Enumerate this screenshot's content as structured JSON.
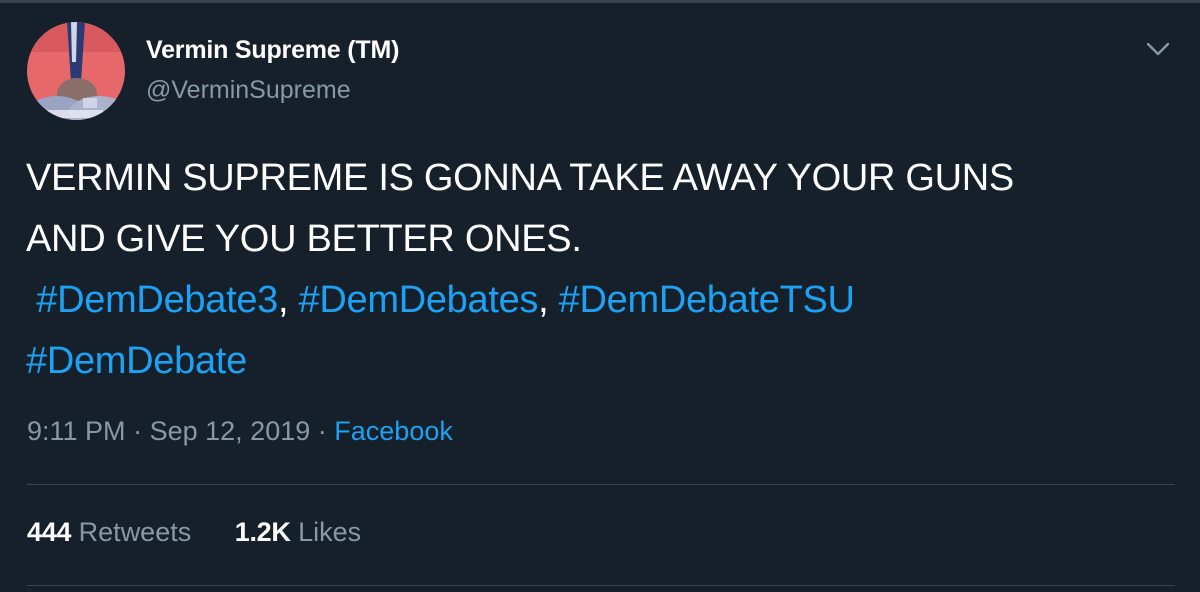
{
  "user": {
    "display_name": "Vermin Supreme (TM)",
    "handle": "@VerminSupreme",
    "avatar_icon": "avatar-icon"
  },
  "menu": {
    "icon": "chevron-down-icon"
  },
  "tweet": {
    "line1": "VERMIN SUPREME IS GONNA TAKE AWAY YOUR GUNS",
    "line2": "AND GIVE YOU BETTER ONES.",
    "hashtags": [
      "#DemDebate3",
      "#DemDebates",
      "#DemDebateTSU",
      "#DemDebate"
    ],
    "separator": ","
  },
  "meta": {
    "time": "9:11 PM",
    "dot": "·",
    "date": "Sep 12, 2019",
    "source": "Facebook"
  },
  "stats": {
    "retweets_count": "444",
    "retweets_label": "Retweets",
    "likes_count": "1.2K",
    "likes_label": "Likes"
  },
  "colors": {
    "background": "#15202b",
    "link": "#1da1f2",
    "muted": "#8899a6",
    "divider": "#38444d"
  }
}
